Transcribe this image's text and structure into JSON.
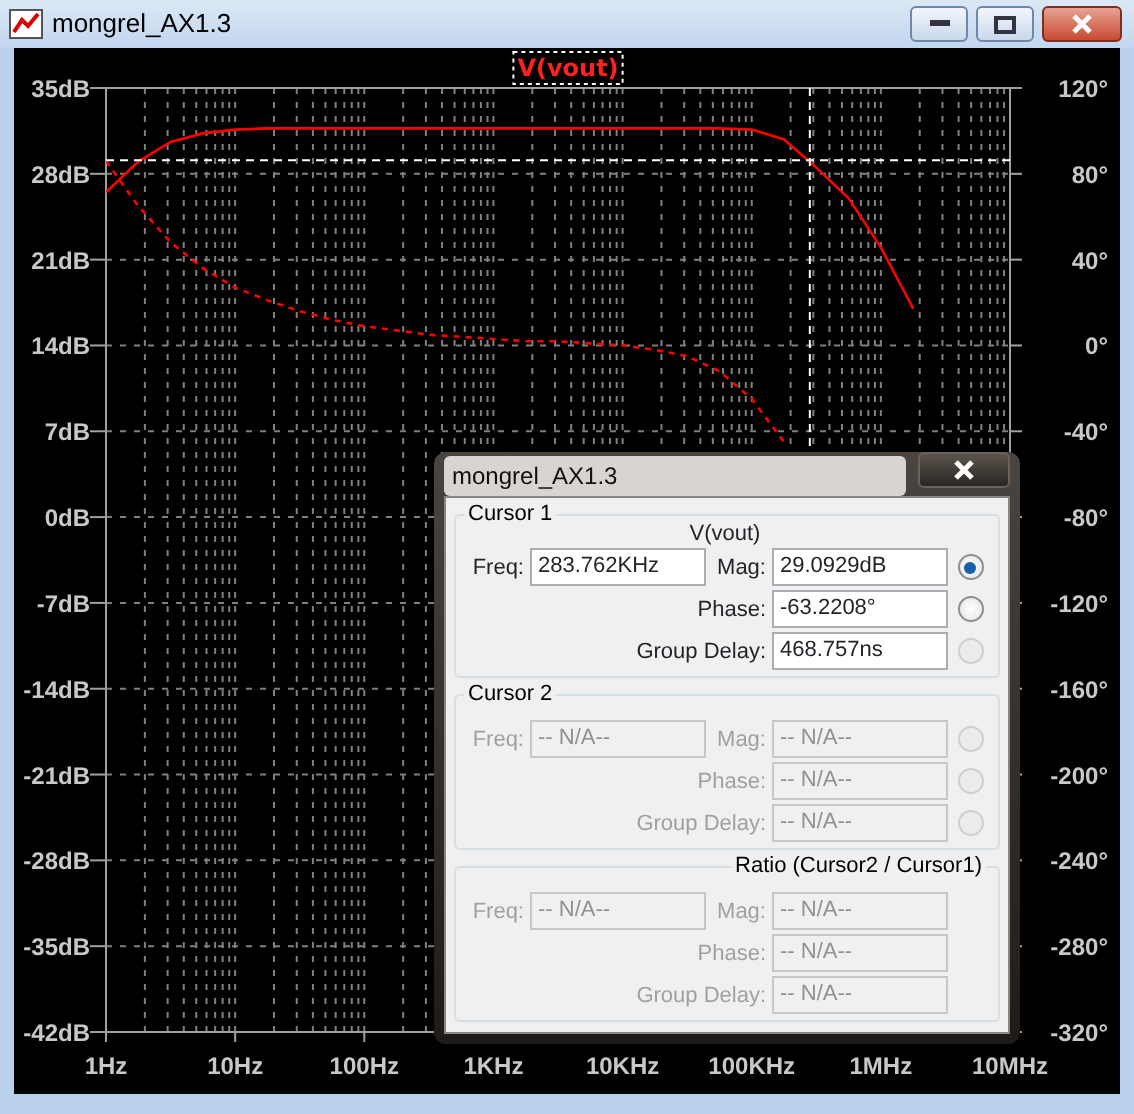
{
  "window": {
    "title": "mongrel_AX1.3"
  },
  "plot": {
    "chart_data": {
      "type": "line",
      "title": "V(vout)",
      "grid": true,
      "ylim": [
        -42,
        35
      ],
      "categories": [
        "1Hz",
        null,
        null,
        null,
        "10Hz",
        null,
        null,
        null,
        "100Hz",
        null,
        null,
        null,
        "1KHz",
        null,
        null,
        null,
        "10KHz",
        null,
        null,
        null,
        "100KHz",
        null,
        null,
        null,
        "1MHz",
        null,
        null,
        null,
        "10MHz"
      ],
      "series": [
        {
          "color": "#ff0000",
          "values": [
            26.5,
            29,
            30.6,
            31.3,
            31.6,
            31.7,
            31.7,
            31.7,
            31.7,
            31.7,
            31.7,
            31.7,
            31.7,
            31.7,
            31.7,
            31.7,
            31.7,
            31.7,
            31.7,
            31.7,
            31.6,
            30.8,
            28.5,
            26,
            22,
            17,
            null,
            null,
            null
          ]
        },
        {
          "color": "#ff0000",
          "axis": "y2",
          "line_style": "dashed",
          "values": [
            86,
            65,
            48,
            36,
            27,
            21,
            16,
            12,
            9,
            7,
            5,
            4,
            3,
            2,
            2,
            1,
            0,
            -2,
            -5,
            -12,
            -25,
            -45,
            null,
            null,
            null,
            null,
            null,
            null,
            null
          ]
        }
      ],
      "yticks": [
        {
          "value": 35,
          "label": "35dB"
        },
        {
          "value": 28,
          "label": "28dB"
        },
        {
          "value": 21,
          "label": "21dB"
        },
        {
          "value": 14,
          "label": "14dB"
        },
        {
          "value": 7,
          "label": "7dB"
        },
        {
          "value": 0,
          "label": "0dB"
        },
        {
          "value": -7,
          "label": "-7dB"
        },
        {
          "value": -14,
          "label": "-14dB"
        },
        {
          "value": -21,
          "label": "-21dB"
        },
        {
          "value": -28,
          "label": "-28dB"
        },
        {
          "value": -35,
          "label": "-35dB"
        },
        {
          "value": -42,
          "label": "-42dB"
        }
      ],
      "y2ticks": [
        {
          "value": 120,
          "label": "120°"
        },
        {
          "value": 80,
          "label": "80°"
        },
        {
          "value": 40,
          "label": "40°"
        },
        {
          "value": 0,
          "label": "0°"
        },
        {
          "value": -40,
          "label": "-40°"
        },
        {
          "value": -80,
          "label": "-80°"
        },
        {
          "value": -120,
          "label": "-120°"
        },
        {
          "value": -160,
          "label": "-160°"
        },
        {
          "value": -200,
          "label": "-200°"
        },
        {
          "value": -240,
          "label": "-240°"
        },
        {
          "value": -280,
          "label": "-280°"
        },
        {
          "value": -320,
          "label": "-320°"
        }
      ],
      "y2lim": [
        -320,
        120
      ],
      "ref_lines": [
        {
          "axis": "y",
          "value": 29.1
        }
      ]
    }
  },
  "cursor_dialog": {
    "title": "mongrel_AX1.3",
    "sections": [
      {
        "kind": "cursor",
        "legend": "Cursor 1",
        "trace": "V(vout)",
        "disabled": false,
        "freq": {
          "label": "Freq:",
          "value": "283.762KHz"
        },
        "rows": [
          {
            "label": "Mag:",
            "value": "29.0929dB",
            "radio": {
              "selected": true,
              "disabled": false
            }
          },
          {
            "label": "Phase:",
            "value": "-63.2208°",
            "radio": {
              "selected": false,
              "disabled": false
            }
          },
          {
            "label": "Group Delay:",
            "value": "468.757ns",
            "radio": {
              "selected": false,
              "disabled": true
            }
          }
        ]
      },
      {
        "kind": "cursor",
        "legend": "Cursor 2",
        "disabled": true,
        "freq": {
          "label": "Freq:",
          "value": "-- N/A--"
        },
        "rows": [
          {
            "label": "Mag:",
            "value": "-- N/A--",
            "radio": {
              "selected": false,
              "disabled": true
            }
          },
          {
            "label": "Phase:",
            "value": "-- N/A--",
            "radio": {
              "selected": false,
              "disabled": true
            }
          },
          {
            "label": "Group Delay:",
            "value": "-- N/A--",
            "radio": {
              "selected": false,
              "disabled": true
            }
          }
        ]
      },
      {
        "kind": "ratio",
        "legend": "Ratio (Cursor2 / Cursor1)",
        "disabled": true,
        "freq": {
          "label": "Freq:",
          "value": "-- N/A--"
        },
        "rows": [
          {
            "label": "Mag:",
            "value": "-- N/A--"
          },
          {
            "label": "Phase:",
            "value": "-- N/A--"
          },
          {
            "label": "Group Delay:",
            "value": "-- N/A--"
          }
        ]
      }
    ]
  }
}
